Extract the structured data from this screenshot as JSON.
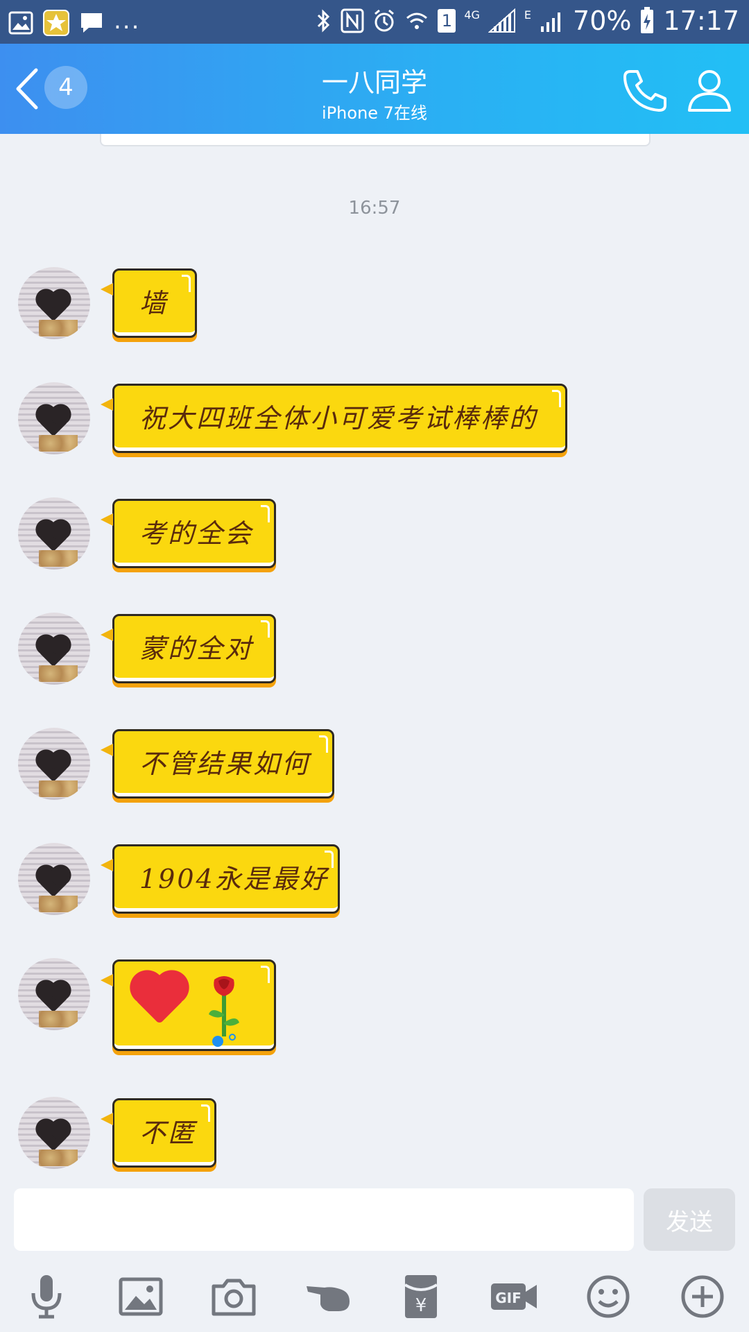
{
  "status_bar": {
    "battery": "70%",
    "time": "17:17",
    "network_labels": [
      "4G",
      "E"
    ],
    "sim_slot": "1",
    "notification_icons": [
      "gallery-icon",
      "star-app-icon",
      "message-icon",
      "more-dots"
    ]
  },
  "header": {
    "unread_count": "4",
    "title": "一八同学",
    "subtitle": "iPhone 7在线"
  },
  "chat": {
    "timestamp": "16:57",
    "messages": [
      {
        "text": "墙"
      },
      {
        "text": "祝大四班全体小可爱考试棒棒的"
      },
      {
        "text": "考的全会"
      },
      {
        "text": "蒙的全对"
      },
      {
        "text": "不管结果如何"
      },
      {
        "text": "1904永是最好"
      },
      {
        "text": "",
        "emojis": [
          "heart-emoji",
          "rose-emoji"
        ]
      },
      {
        "text": "不匿"
      }
    ]
  },
  "input": {
    "value": "",
    "send_label": "发送"
  },
  "toolbar": {
    "icons": [
      "microphone-icon",
      "image-icon",
      "camera-icon",
      "poke-icon",
      "red-packet-icon",
      "gif-icon",
      "emoji-icon",
      "plus-icon"
    ]
  },
  "colors": {
    "status_bar": "#35568a",
    "header_start": "#3d8ff0",
    "header_end": "#22bff5",
    "bubble": "#fbd80f",
    "bubble_text": "#5a2b0c",
    "background": "#eef1f6"
  }
}
